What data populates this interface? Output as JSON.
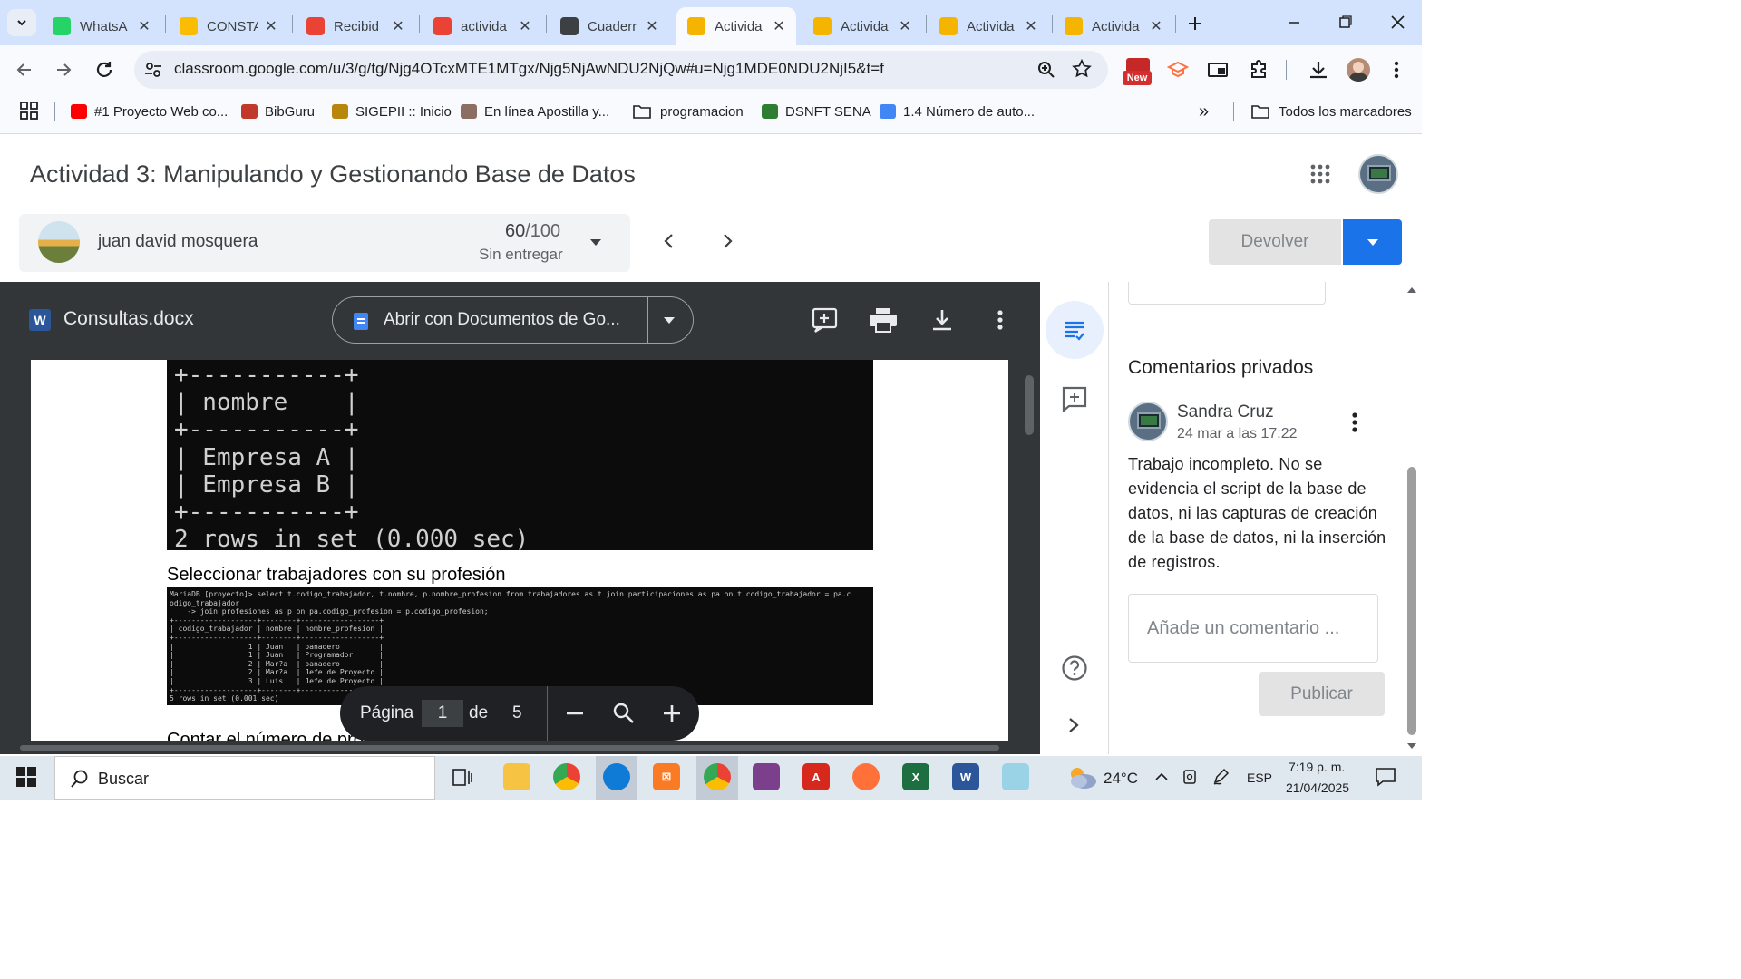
{
  "browser": {
    "tabs": [
      {
        "label": "WhatsA",
        "color": "#25d366"
      },
      {
        "label": "CONSTA",
        "color": "#fbbc04"
      },
      {
        "label": "Recibid",
        "color": "#ea4335"
      },
      {
        "label": "activida",
        "color": "#ea4335"
      },
      {
        "label": "Cuaderr",
        "color": "#3c4043"
      },
      {
        "label": "Activida",
        "color": "#f4b400",
        "active": true
      },
      {
        "label": "Activida",
        "color": "#f4b400"
      },
      {
        "label": "Activida",
        "color": "#f4b400"
      },
      {
        "label": "Activida",
        "color": "#f4b400"
      }
    ],
    "url": "classroom.google.com/u/3/g/tg/Njg4OTcxMTE1MTgx/Njg5NjAwNDU2NjQw#u=Njg1MDE0NDU2NjI5&t=f",
    "new_badge": "New",
    "bookmarks": [
      {
        "label": "#1 Proyecto Web co...",
        "color": "#ff0000"
      },
      {
        "label": "BibGuru",
        "color": "#c0392b"
      },
      {
        "label": "SIGEPII :: Inicio",
        "color": "#b8860b"
      },
      {
        "label": "En línea Apostilla y...",
        "color": "#8d6e63"
      },
      {
        "label": "programacion",
        "color": "folder"
      },
      {
        "label": "DSNFT SENA",
        "color": "#2e7d32"
      },
      {
        "label": "1.4 Número de auto...",
        "color": "#4285f4"
      }
    ],
    "all_bookmarks": "Todos los marcadores"
  },
  "classroom": {
    "title": "Actividad 3: Manipulando y Gestionando Base de Datos",
    "student_name": "juan david mosquera",
    "grade": "60",
    "grade_total": "/100",
    "status": "Sin entregar",
    "return_button": "Devolver"
  },
  "viewer": {
    "file_name": "Consultas.docx",
    "open_with": "Abrir con Documentos de Go...",
    "page_label": "Página",
    "page_current": "1",
    "page_of": "de",
    "page_total": "5"
  },
  "document": {
    "term1": "+-----------+\n| nombre    |\n+-----------+\n| Empresa A |\n| Empresa B |\n+-----------+\n2 rows in set (0.000 sec)",
    "heading1": "Seleccionar trabajadores con su profesión",
    "term2": "MariaDB [proyecto]> select t.codigo_trabajador, t.nombre, p.nombre_profesion from trabajadores as t join participaciones as pa on t.codigo_trabajador = pa.c\nodigo_trabajador\n    -> join profesiones as p on pa.codigo_profesion = p.codigo_profesion;\n+-------------------+--------+------------------+\n| codigo_trabajador | nombre | nombre_profesion |\n+-------------------+--------+------------------+\n|                 1 | Juan   | panadero         |\n|                 1 | Juan   | Programador      |\n|                 2 | Mar?a  | panadero         |\n|                 2 | Mar?a  | Jefe de Proyecto |\n|                 3 | Luis   | Jefe de Proyecto |\n+-------------------+--------+------------------+\n5 rows in set (0.001 sec)",
    "heading2": "Contar el número de proyectos por empresa"
  },
  "comments": {
    "title": "Comentarios privados",
    "author": "Sandra Cruz",
    "date": "24 mar a las 17:22",
    "text": "Trabajo incompleto. No se evidencia el script de la base de datos, ni las capturas de creación de la base de datos, ni la inserción de registros.",
    "placeholder": "Añade un comentario ...",
    "publish": "Publicar"
  },
  "taskbar": {
    "search": "Buscar",
    "temperature": "24°C",
    "language": "ESP",
    "time": "7:19 p. m.",
    "date": "21/04/2025"
  }
}
